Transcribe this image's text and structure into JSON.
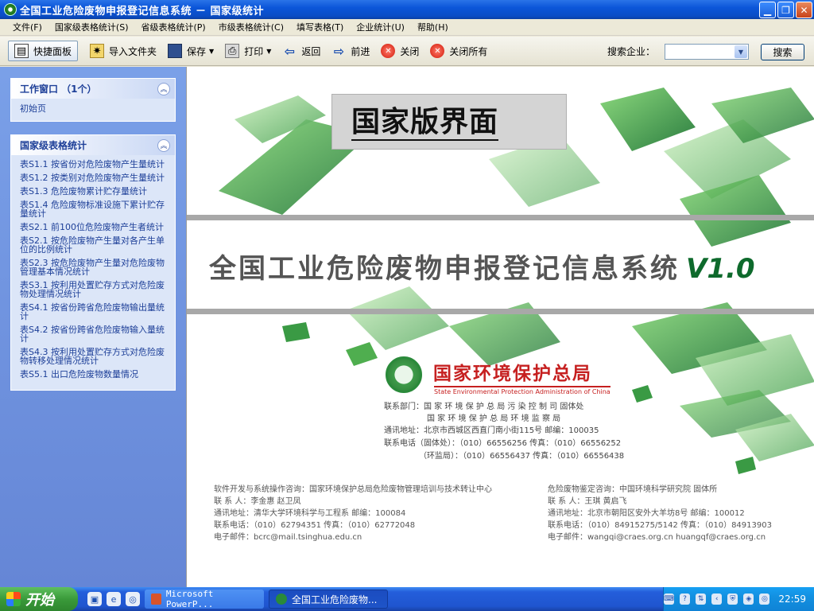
{
  "window": {
    "title": "全国工业危险废物申报登记信息系统 － 国家级统计"
  },
  "menu": [
    "文件(F)",
    "国家级表格统计(S)",
    "省级表格统计(P)",
    "市级表格统计(C)",
    "填写表格(T)",
    "企业统计(U)",
    "帮助(H)"
  ],
  "toolbar": {
    "quick_panel": "快捷面板",
    "import_folder": "导入文件夹",
    "save": "保存",
    "print": "打印",
    "back": "返回",
    "forward": "前进",
    "close": "关闭",
    "close_all": "关闭所有",
    "search_label": "搜索企业：",
    "search_select_value": "",
    "search_button": "搜索"
  },
  "sidebar": {
    "work_panel": {
      "title": "工作窗口 （1个）",
      "items": [
        "初始页"
      ]
    },
    "national_panel": {
      "title": "国家级表格统计",
      "items": [
        "表S1.1 按省份对危险废物产生量统计",
        "表S1.2 按类别对危险废物产生量统计",
        "表S1.3 危险废物累计贮存量统计",
        "表S1.4 危险废物标准设施下累计贮存量统计",
        "表S2.1 前100位危险废物产生者统计",
        "表S2.1 按危险废物产生量对各产生单位的比例统计",
        "表S2.3 按危险废物产生量对危险废物管理基本情况统计",
        "表S3.1 按利用处置贮存方式对危险废物处理情况统计",
        "表S4.1 按省份跨省危险废物输出量统计",
        "表S4.2 按省份跨省危险废物输入量统计",
        "表S4.3 按利用处置贮存方式对危险废物转移处理情况统计",
        "表S5.1 出口危险废物数量情况"
      ]
    }
  },
  "splash": {
    "banner": "国家版界面",
    "system_title": "全国工业危险废物申报登记信息系统",
    "version": "V1.0",
    "agency_zh": "国家环境保护总局",
    "agency_en": "State Environmental Protection Administration of China",
    "contact_lines": [
      "联系部门：国 家 环 境 保 护 总 局 污 染 控 制 司      固体处",
      "国 家 环 境 保 护 总 局 环 境 监 察 局",
      "通讯地址：北京市西城区西直门南小街115号        邮编：100035",
      "联系电话（固体处）：（010）66556256   传真：（010）66556252",
      "（环监局）：（010）66556437   传真：（010）66556438"
    ],
    "footer_left": [
      "软件开发与系统操作咨询：国家环境保护总局危险废物管理培训与技术转让中心",
      "联 系 人：李金惠  赵卫凤",
      "通讯地址：清华大学环境科学与工程系    邮编：100084",
      "联系电话：（010）62794351   传真：（010）62772048",
      "电子邮件：bcrc@mail.tsinghua.edu.cn"
    ],
    "footer_right": [
      "危险废物鉴定咨询：中国环境科学研究院  固体所",
      "联 系 人：王琪  黄启飞",
      "通讯地址：北京市朝阳区安外大羊坊8号      邮编：100012",
      "联系电话：（010）84915275/5142   传真：（010）84913903",
      "电子邮件：wangqi@craes.org.cn  huangqf@craes.org.cn"
    ]
  },
  "taskbar": {
    "start": "开始",
    "tasks": [
      "Microsoft PowerP...",
      "全国工业危险废物..."
    ],
    "clock": "22:59"
  },
  "colors": {
    "titlebar": "#0b56d9",
    "sidebar_bg": "#6d8fdc",
    "link_blue": "#1d3f98",
    "brand_green": "#0e6a2c",
    "agency_red": "#c62020"
  }
}
